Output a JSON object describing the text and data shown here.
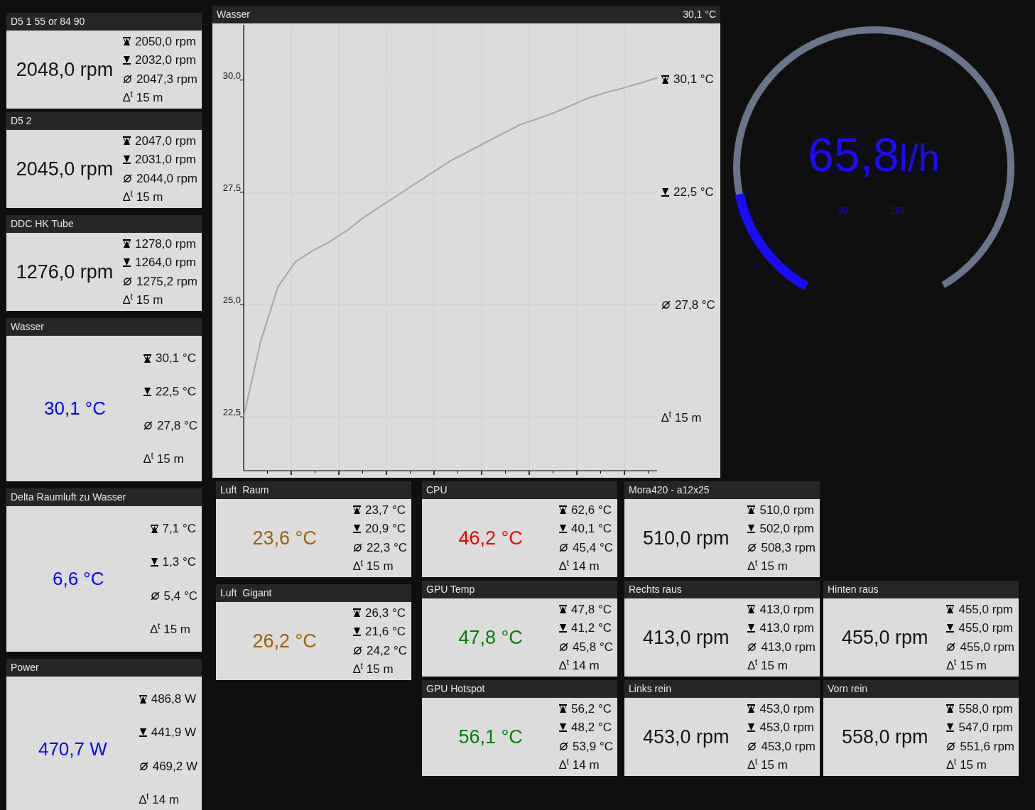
{
  "left_column": [
    {
      "title": "D5 1 55 or 84 90",
      "value": "2048,0 rpm",
      "color": "#1a1010",
      "tall": false,
      "stats": [
        {
          "kind": "max",
          "text": "2050,0 rpm"
        },
        {
          "kind": "min",
          "text": "2032,0 rpm"
        },
        {
          "kind": "avg",
          "text": "2047,3 rpm"
        },
        {
          "kind": "elapsed",
          "text": "∆$^{t}$ 15 m"
        }
      ]
    },
    {
      "title": "D5 2",
      "value": "2045,0 rpm",
      "color": "#1a1010",
      "tall": false,
      "stats": [
        {
          "kind": "max",
          "text": "2047,0 rpm"
        },
        {
          "kind": "min",
          "text": "2031,0 rpm"
        },
        {
          "kind": "avg",
          "text": "2044,0 rpm"
        },
        {
          "kind": "elapsed",
          "text": "∆$^{t}$ 15 m"
        }
      ]
    },
    {
      "title": "DDC HK Tube",
      "value": "1276,0 rpm",
      "color": "#1a1010",
      "tall": false,
      "stats": [
        {
          "kind": "max",
          "text": "1278,0 rpm"
        },
        {
          "kind": "min",
          "text": "1264,0 rpm"
        },
        {
          "kind": "avg",
          "text": "1275,2 rpm"
        },
        {
          "kind": "elapsed",
          "text": "∆$^{t}$ 15 m"
        }
      ]
    },
    {
      "title": "Wasser",
      "value": "30,1 °C",
      "color": "#0000ff",
      "tall": true,
      "stats": [
        {
          "kind": "max",
          "text": "30,1 °C"
        },
        {
          "kind": "min",
          "text": "22,5 °C"
        },
        {
          "kind": "avg",
          "text": "27,8 °C"
        },
        {
          "kind": "elapsed",
          "text": "∆$^{t}$ 15 m"
        }
      ]
    },
    {
      "title": "Delta Raumluft zu Wasser",
      "value": "6,6 °C",
      "color": "#0000ff",
      "tall": true,
      "stats": [
        {
          "kind": "max",
          "text": "7,1 °C"
        },
        {
          "kind": "min",
          "text": "1,3 °C"
        },
        {
          "kind": "avg",
          "text": "5,4 °C"
        },
        {
          "kind": "elapsed",
          "text": "∆$^{t}$ 15 m"
        }
      ]
    },
    {
      "title": "Power",
      "value": "470,7 W",
      "color": "#0000ff",
      "tall": true,
      "stats": [
        {
          "kind": "max",
          "text": "486,8 W"
        },
        {
          "kind": "min",
          "text": "441,9 W"
        },
        {
          "kind": "avg",
          "text": "469,2 W"
        },
        {
          "kind": "elapsed",
          "text": "∆$^{t}$ 14 m"
        }
      ]
    }
  ],
  "chart_panel": {
    "title": "Wasser",
    "reading": "30,1 °C",
    "stats": [
      {
        "kind": "max",
        "text": "30,1 °C"
      },
      {
        "kind": "min",
        "text": "22,5 °C"
      },
      {
        "kind": "avg",
        "text": "27,8 °C"
      },
      {
        "kind": "elapsed",
        "text": "∆$^{t}$ 15 m"
      }
    ],
    "chart_data": {
      "type": "line",
      "grid": true,
      "ylim": [
        21.3,
        31.23
      ],
      "yticks": [
        {
          "value": 22.5,
          "label": "22,5"
        },
        {
          "value": 25,
          "label": "25,0"
        },
        {
          "value": 27.5,
          "label": "27,5"
        },
        {
          "value": 30,
          "label": "30,0"
        }
      ],
      "series": [
        {
          "color": "#a8a8a8",
          "values": [
            22.5,
            24.2,
            25.4,
            25.95,
            26.2,
            26.4,
            26.65,
            26.95,
            27.2,
            27.45,
            27.7,
            27.95,
            28.2,
            28.4,
            28.6,
            28.8,
            29.0,
            29.13,
            29.27,
            29.43,
            29.6,
            29.72,
            29.82,
            29.93,
            30.05
          ]
        }
      ]
    }
  },
  "flow_gauge": {
    "value": "65,8",
    "unit": "l/h",
    "min": "30",
    "max": "250",
    "level": 0.163
  },
  "bottom_columns": [
    [
      {
        "title": "Luft  Raum",
        "value": "23,6 °C",
        "color": "#a0600a",
        "tall": false,
        "stats": [
          {
            "kind": "max",
            "text": "23,7 °C"
          },
          {
            "kind": "min",
            "text": "20,9 °C"
          },
          {
            "kind": "avg",
            "text": "22,3 °C"
          },
          {
            "kind": "elapsed",
            "text": "∆$^{t}$ 15 m"
          }
        ]
      },
      {
        "title": "Luft  Gigant",
        "value": "26,2 °C",
        "color": "#a0600a",
        "tall": false,
        "stats": [
          {
            "kind": "max",
            "text": "26,3 °C"
          },
          {
            "kind": "min",
            "text": "21,6 °C"
          },
          {
            "kind": "avg",
            "text": "24,2 °C"
          },
          {
            "kind": "elapsed",
            "text": "∆$^{t}$ 15 m"
          }
        ]
      }
    ],
    [
      {
        "title": "CPU",
        "value": "46,2 °C",
        "color": "#ee0000",
        "tall": false,
        "stats": [
          {
            "kind": "max",
            "text": "62,6 °C"
          },
          {
            "kind": "min",
            "text": "40,1 °C"
          },
          {
            "kind": "avg",
            "text": "45,4 °C"
          },
          {
            "kind": "elapsed",
            "text": "∆$^{t}$ 14 m"
          }
        ]
      },
      {
        "title": "GPU Temp",
        "value": "47,8 °C",
        "color": "#008000",
        "tall": false,
        "stats": [
          {
            "kind": "max",
            "text": "47,8 °C"
          },
          {
            "kind": "min",
            "text": "41,2 °C"
          },
          {
            "kind": "avg",
            "text": "45,8 °C"
          },
          {
            "kind": "elapsed",
            "text": "∆$^{t}$ 14 m"
          }
        ]
      },
      {
        "title": "GPU Hotspot",
        "value": "56,1 °C",
        "color": "#008000",
        "tall": false,
        "stats": [
          {
            "kind": "max",
            "text": "56,2 °C"
          },
          {
            "kind": "min",
            "text": "48,2 °C"
          },
          {
            "kind": "avg",
            "text": "53,9 °C"
          },
          {
            "kind": "elapsed",
            "text": "∆$^{t}$ 14 m"
          }
        ]
      }
    ],
    [
      {
        "title": "Mora420 - a12x25",
        "value": "510,0 rpm",
        "color": "#1a1010",
        "tall": false,
        "stats": [
          {
            "kind": "max",
            "text": "510,0 rpm"
          },
          {
            "kind": "min",
            "text": "502,0 rpm"
          },
          {
            "kind": "avg",
            "text": "508,3 rpm"
          },
          {
            "kind": "elapsed",
            "text": "∆$^{t}$ 15 m"
          }
        ]
      },
      {
        "title": "Rechts raus",
        "value": "413,0 rpm",
        "color": "#1a1010",
        "tall": false,
        "stats": [
          {
            "kind": "max",
            "text": "413,0 rpm"
          },
          {
            "kind": "min",
            "text": "413,0 rpm"
          },
          {
            "kind": "avg",
            "text": "413,0 rpm"
          },
          {
            "kind": "elapsed",
            "text": "∆$^{t}$ 15 m"
          }
        ]
      },
      {
        "title": "Links rein",
        "value": "453,0 rpm",
        "color": "#1a1010",
        "tall": false,
        "stats": [
          {
            "kind": "max",
            "text": "453,0 rpm"
          },
          {
            "kind": "min",
            "text": "453,0 rpm"
          },
          {
            "kind": "avg",
            "text": "453,0 rpm"
          },
          {
            "kind": "elapsed",
            "text": "∆$^{t}$ 15 m"
          }
        ]
      }
    ],
    [
      {
        "title": "Hinten raus",
        "value": "455,0 rpm",
        "color": "#1a1010",
        "tall": false,
        "stats": [
          {
            "kind": "max",
            "text": "455,0 rpm"
          },
          {
            "kind": "min",
            "text": "455,0 rpm"
          },
          {
            "kind": "avg",
            "text": "455,0 rpm"
          },
          {
            "kind": "elapsed",
            "text": "∆$^{t}$ 15 m"
          }
        ]
      },
      {
        "title": "Vorn rein",
        "value": "558,0 rpm",
        "color": "#1a1010",
        "tall": false,
        "stats": [
          {
            "kind": "max",
            "text": "558,0 rpm"
          },
          {
            "kind": "min",
            "text": "547,0 rpm"
          },
          {
            "kind": "avg",
            "text": "551,6 rpm"
          },
          {
            "kind": "elapsed",
            "text": "∆$^{t}$ 15 m"
          }
        ]
      }
    ]
  ]
}
